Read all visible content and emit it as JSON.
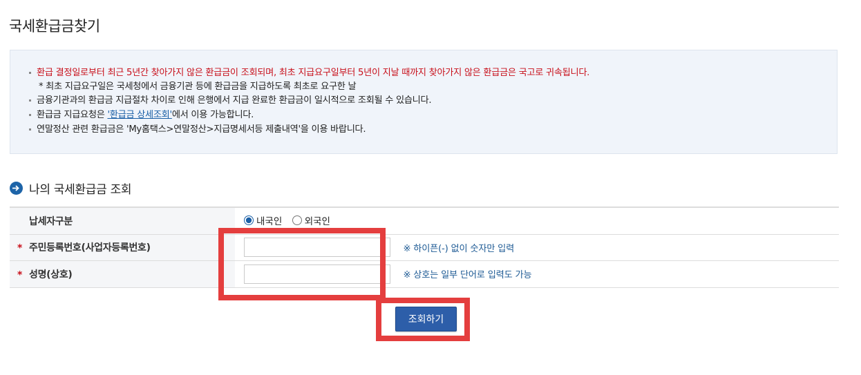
{
  "page": {
    "title": "국세환급금찾기"
  },
  "notice": {
    "items": [
      {
        "text": "환급 결정일로부터 최근 5년간 찾아가지 않은 환급금이 조회되며, 최초 지급요구일부터 5년이 지날 때까지 찾아가지 않은 환급금은 국고로 귀속됩니다."
      },
      {
        "text": "* 최초 지급요구일은 국세청에서 금융기관 등에 환급금을 지급하도록 최초로 요구한 날"
      },
      {
        "text": "금융기관과의 환급금 지급절차 차이로 인해 은행에서 지급 완료한 환급금이 일시적으로 조회될 수 있습니다."
      },
      {
        "prefix": "환급금 지급요청은 ",
        "link": "'환급금 상세조회'",
        "suffix": "에서 이용 가능합니다."
      },
      {
        "text": "연말정산 관련 환급금은 'My홈택스>연말정산>지급명세서등 제출내역'을 이용 바랍니다."
      }
    ]
  },
  "section": {
    "title": "나의 국세환급금 조회"
  },
  "form": {
    "taxpayer_type": {
      "label": "납세자구분",
      "options": [
        "내국인",
        "외국인"
      ],
      "selected": "내국인"
    },
    "id_number": {
      "required_mark": "*",
      "label": "주민등록번호(사업자등록번호)",
      "value": "",
      "hint": "※ 하이픈(-) 없이 숫자만 입력"
    },
    "name": {
      "required_mark": "*",
      "label": "성명(상호)",
      "value": "",
      "hint": "※ 상호는 일부 단어로 입력도 가능"
    }
  },
  "search_button": {
    "label": "조회하기"
  },
  "colors": {
    "notice_red": "#c8101b",
    "link_blue": "#1a5fa6",
    "button_blue": "#2d5ea9",
    "highlight_red": "#e43e3e",
    "notice_bg": "#f0f4fa"
  }
}
